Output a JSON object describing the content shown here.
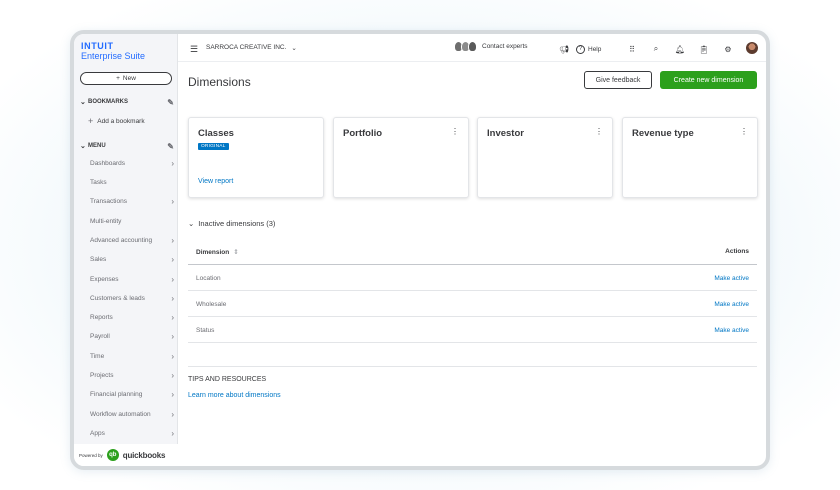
{
  "brand": {
    "top": "INTUIT",
    "bottom": "Enterprise Suite"
  },
  "sidebar": {
    "new_label": "New",
    "bookmarks_label": "BOOKMARKS",
    "add_bookmark": "Add a bookmark",
    "menu_label": "MENU",
    "items": [
      {
        "label": "Dashboards",
        "has_arrow": true
      },
      {
        "label": "Tasks",
        "has_arrow": false
      },
      {
        "label": "Transactions",
        "has_arrow": true
      },
      {
        "label": "Multi-entity",
        "has_arrow": false
      },
      {
        "label": "Advanced accounting",
        "has_arrow": true
      },
      {
        "label": "Sales",
        "has_arrow": true
      },
      {
        "label": "Expenses",
        "has_arrow": true
      },
      {
        "label": "Customers & leads",
        "has_arrow": true
      },
      {
        "label": "Reports",
        "has_arrow": true
      },
      {
        "label": "Payroll",
        "has_arrow": true
      },
      {
        "label": "Time",
        "has_arrow": true
      },
      {
        "label": "Projects",
        "has_arrow": true
      },
      {
        "label": "Financial planning",
        "has_arrow": true
      },
      {
        "label": "Workflow automation",
        "has_arrow": true
      },
      {
        "label": "Apps",
        "has_arrow": true
      }
    ],
    "powered_by": "Powered by",
    "qb_word": "quickbooks"
  },
  "topbar": {
    "company": "SARROCA CREATIVE INC.",
    "contact_experts": "Contact experts",
    "help": "Help"
  },
  "page": {
    "title": "Dimensions",
    "feedback_button": "Give feedback",
    "create_button": "Create new dimension"
  },
  "cards": [
    {
      "title": "Classes",
      "badge": "ORIGINAL",
      "link": "View report",
      "kebab": false
    },
    {
      "title": "Portfolio",
      "kebab": true
    },
    {
      "title": "Investor",
      "kebab": true
    },
    {
      "title": "Revenue type",
      "kebab": true
    }
  ],
  "inactive": {
    "heading": "Inactive dimensions (3)",
    "col_dimension": "Dimension",
    "col_actions": "Actions",
    "rows": [
      {
        "name": "Location",
        "action": "Make active"
      },
      {
        "name": "Wholesale",
        "action": "Make active"
      },
      {
        "name": "Status",
        "action": "Make active"
      }
    ]
  },
  "tips": {
    "title": "TIPS AND RESOURCES",
    "link": "Learn more about dimensions"
  },
  "colors": {
    "primary_green": "#2ca01c",
    "link_blue": "#0077c5",
    "brand_blue": "#236cff"
  }
}
